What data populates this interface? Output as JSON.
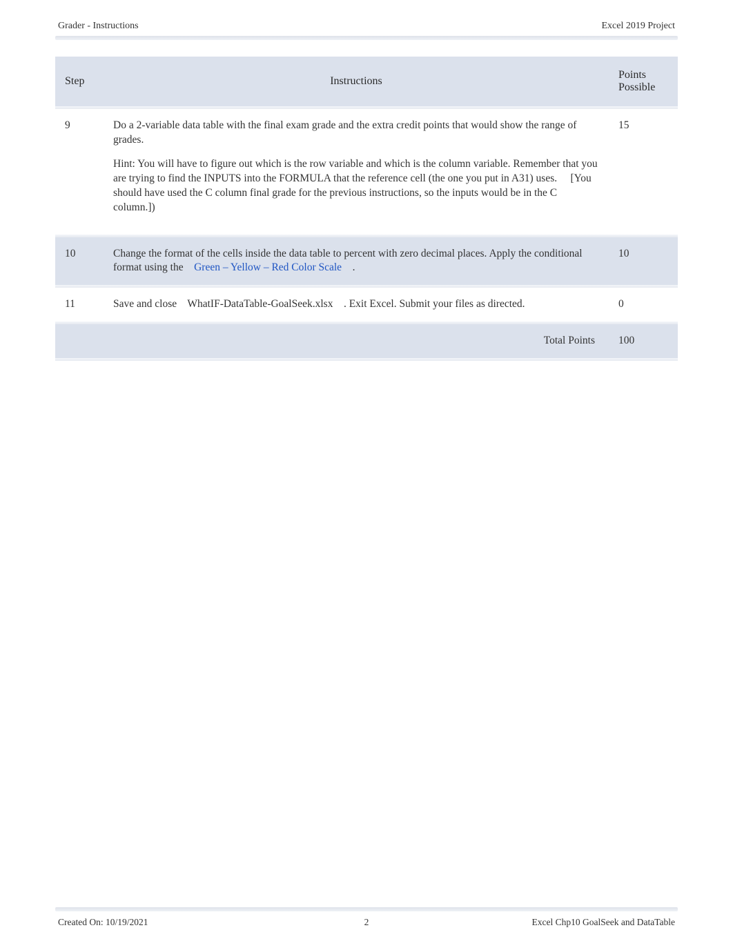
{
  "header": {
    "left": "Grader - Instructions",
    "right": "Excel 2019 Project"
  },
  "columns": {
    "step": "Step",
    "instructions": "Instructions",
    "points": "Points Possible"
  },
  "rows": {
    "r9": {
      "step": "9",
      "p1": "Do a 2-variable data table with the final exam grade and the extra credit points that would show the range of grades.",
      "p2a": "Hint: You will have to figure out which is the row variable and which is the column variable. Remember that you are trying to find the INPUTS into the FORMULA that the reference cell (the one you put in A31) uses.",
      "p2b": "[You should have used the C column final grade for the previous instructions, so the inputs would be in the C column.])",
      "points": "15"
    },
    "r10": {
      "step": "10",
      "t1": "Change the format of the cells inside the data table to percent with zero decimal places. Apply the conditional format using the ",
      "t_blue": "Green – Yellow – Red Color Scale",
      "t2": ".",
      "points": "10"
    },
    "r11": {
      "step": "11",
      "t1": "Save and close ",
      "t_file": "WhatIF-DataTable-GoalSeek.xlsx",
      "t2": ". Exit Excel. Submit your files as directed.",
      "points": "0"
    },
    "total": {
      "label": "Total Points",
      "value": "100"
    }
  },
  "footer": {
    "left": "Created On: 10/19/2021",
    "center": "2",
    "right": "Excel Chp10 GoalSeek and DataTable"
  }
}
